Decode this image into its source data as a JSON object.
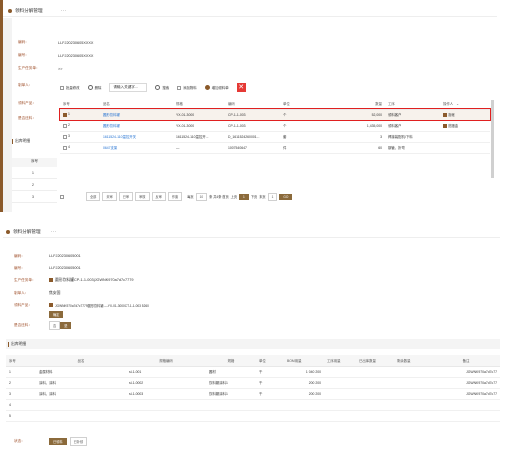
{
  "top": {
    "tab_title": "领料分解管理",
    "tab_more": "···",
    "fields": [
      {
        "label": "编码：",
        "value": "LLFJ20230605XXXX"
      },
      {
        "label": "编号：",
        "value": "LLFJ20230605XXXX"
      },
      {
        "label": "生产任务单：",
        "value": ">>"
      },
      {
        "label": "制单人：",
        "value": ""
      },
      {
        "label": "领料产品：",
        "value": ""
      },
      {
        "label": "是否还料：",
        "value": ""
      }
    ],
    "toolbar": {
      "selected_label": "批量修改",
      "delete_label": "删除",
      "search_placeholder": "请输入关键字...",
      "search_btn": "搜索",
      "quick_add": "添加物料",
      "mode_label": "增加领料单"
    },
    "table": {
      "headers": [
        "序号",
        "品名",
        "规格",
        "编码",
        "单位",
        "数量",
        "工序",
        "操作人"
      ],
      "rows": [
        {
          "no": "1",
          "name": "圆形饮料罐",
          "spec": "YX-01-3000",
          "code": "CP-1-1-003",
          "unit": "个",
          "qty": "52,000",
          "proc": "领料客户",
          "op": "泡帐"
        },
        {
          "no": "2",
          "name": "圆形饮料罐",
          "spec": "YX-01-3000",
          "code": "CP-1-1-003",
          "unit": "个",
          "qty": "1,435,000",
          "proc": "领料客户",
          "op": "范腊金"
        },
        {
          "no": "3",
          "name": "1611524-110温控开关",
          "spec": "1611524-110温控开...",
          "code": "D_1611524260001...",
          "unit": "套",
          "qty": "3",
          "proc": "焊接装配机/下料",
          "op": ""
        },
        {
          "no": "4",
          "name": "0647支架",
          "spec": "—",
          "code": "1007540647",
          "unit": "件",
          "qty": "60",
          "proc": "钢管、折弯",
          "op": ""
        }
      ],
      "sort_icon": "chevron-down-icon"
    },
    "left_sub": {
      "title": "出库明细",
      "header": "序号",
      "rows": [
        "1",
        "2",
        "3"
      ]
    },
    "pager": {
      "filters": [
        "全部",
        "未审",
        "已审",
        "审核",
        "反审",
        "作废"
      ],
      "size_label": "每页",
      "size": "10",
      "total": "条 共4条 首页",
      "prev": "上页",
      "page": "1",
      "next": "下页",
      "last": "末页",
      "go_label": "1",
      "go_btn": "GO"
    }
  },
  "bottom": {
    "tab_title": "领料分解管理",
    "tab_more": "···",
    "fields": [
      {
        "label": "编码：",
        "value": "LLFJ20230605001"
      },
      {
        "label": "编号：",
        "value": "LLFJ20230605001"
      },
      {
        "label": "生产任务单：",
        "value": "圆形饮料罐CP-1-1-003|JGWNK970a7d7c7779"
      },
      {
        "label": "制单人：",
        "value": "焦安国"
      },
      {
        "label": "领料产品：",
        "value": "JGWNK970a7d7c7779圆形饮料罐----YX-01-3000CT-1-1-003 5260"
      },
      {
        "label": "是否还料：",
        "value": ""
      }
    ],
    "product_btn": "确定",
    "return_yes": "否",
    "return_no": "是",
    "section_title": "出库明细",
    "table": {
      "headers": [
        "序号",
        "品名",
        "规格编码",
        "规格",
        "单位",
        "BOM用量",
        "工序用量",
        "已出库数量",
        "剩余数量",
        "备注"
      ],
      "rows": [
        {
          "no": "1",
          "name": "金属材料",
          "code": "sl-1-001",
          "spec": "圆材",
          "unit": "千",
          "bom": "1 040 200",
          "proc": "",
          "out": "",
          "left": "",
          "note": "JGWNK970a7d7c77"
        },
        {
          "no": "2",
          "name": "涂料、涂料",
          "code": "sl-1-0002",
          "spec": "饮料罐涂料1",
          "unit": "千",
          "bom": "200 200",
          "proc": "",
          "out": "",
          "left": "",
          "note": "JGWNK970a7d7c77"
        },
        {
          "no": "3",
          "name": "涂料、涂料",
          "code": "sl-1-0003",
          "spec": "饮料罐涂料1",
          "unit": "千",
          "bom": "200 200",
          "proc": "",
          "out": "",
          "left": "",
          "note": "JGWNK970a7d7c77"
        },
        {
          "no": "4",
          "name": "",
          "code": "",
          "spec": "",
          "unit": "",
          "bom": "",
          "proc": "",
          "out": "",
          "left": "",
          "note": ""
        },
        {
          "no": "5",
          "name": "",
          "code": "",
          "spec": "",
          "unit": "",
          "bom": "",
          "proc": "",
          "out": "",
          "left": "",
          "note": ""
        }
      ]
    },
    "status_label": "状态：",
    "status_options": [
      "已领料",
      "已补领"
    ]
  },
  "colors": {
    "accent": "#8b5a2b",
    "highlight": "#e02020",
    "link": "#1f6fd1"
  }
}
